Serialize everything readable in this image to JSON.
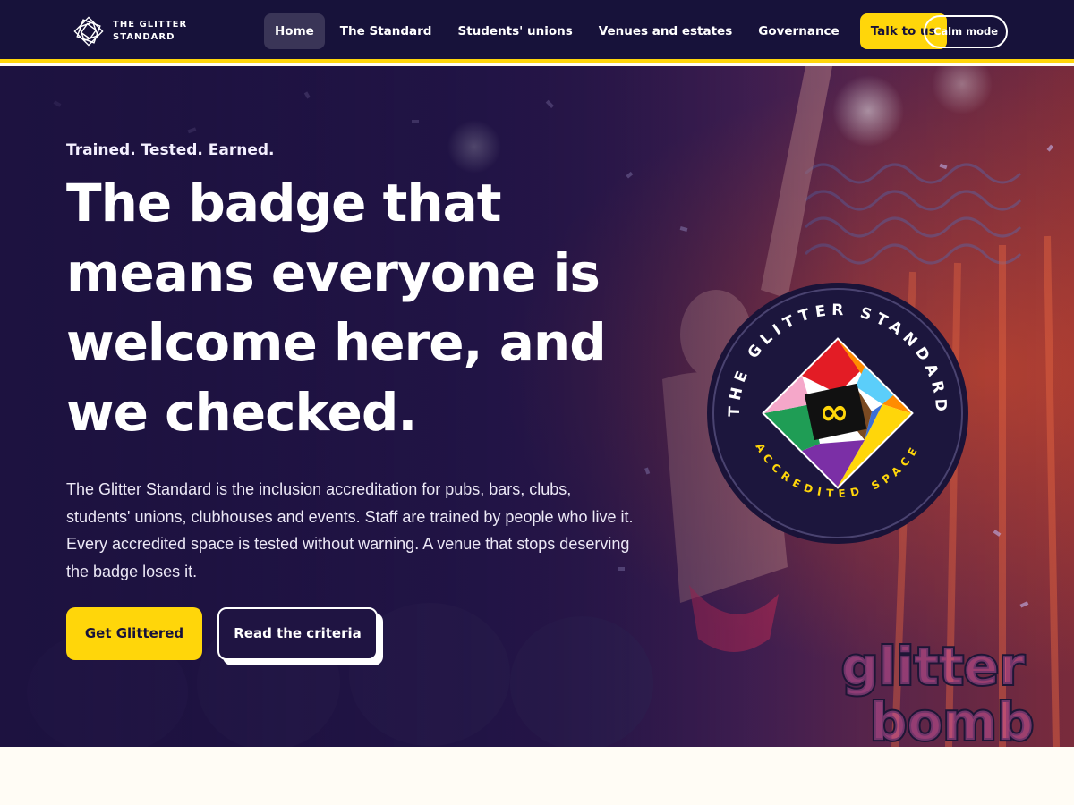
{
  "brand": {
    "line1": "THE GLITTER",
    "line2": "STANDARD",
    "logo_icon": "glitter-diamond-logo"
  },
  "nav": {
    "items": [
      {
        "label": "Home",
        "active": true
      },
      {
        "label": "The Standard",
        "active": false
      },
      {
        "label": "Students' unions",
        "active": false
      },
      {
        "label": "Venues and estates",
        "active": false
      },
      {
        "label": "Governance",
        "active": false
      }
    ],
    "cta_label": "Talk to us",
    "calm_label": "Calm mode"
  },
  "hero": {
    "kicker": "Trained. Tested. Earned.",
    "headline": "The badge that means everyone is welcome here, and we checked.",
    "lede": "The Glitter Standard is the inclusion accreditation for pubs, bars, clubs, students' unions, clubhouses and events. Staff are trained by people who live it. Every accredited space is tested without warning. A venue that stops deserving the badge loses it.",
    "primary_button": "Get Glittered",
    "secondary_button": "Read the criteria"
  },
  "badge": {
    "top_text": "THE GLITTER STANDARD",
    "bottom_text": "ACCREDITED SPACE",
    "center_icon": "infinity-icon"
  },
  "watermark": {
    "line1": "glitter",
    "line2": "bomb"
  },
  "colors": {
    "navy": "#17123a",
    "accent_yellow": "#ffd60a",
    "nav_active_bg": "#3a3557",
    "cream": "#fffcf5"
  }
}
